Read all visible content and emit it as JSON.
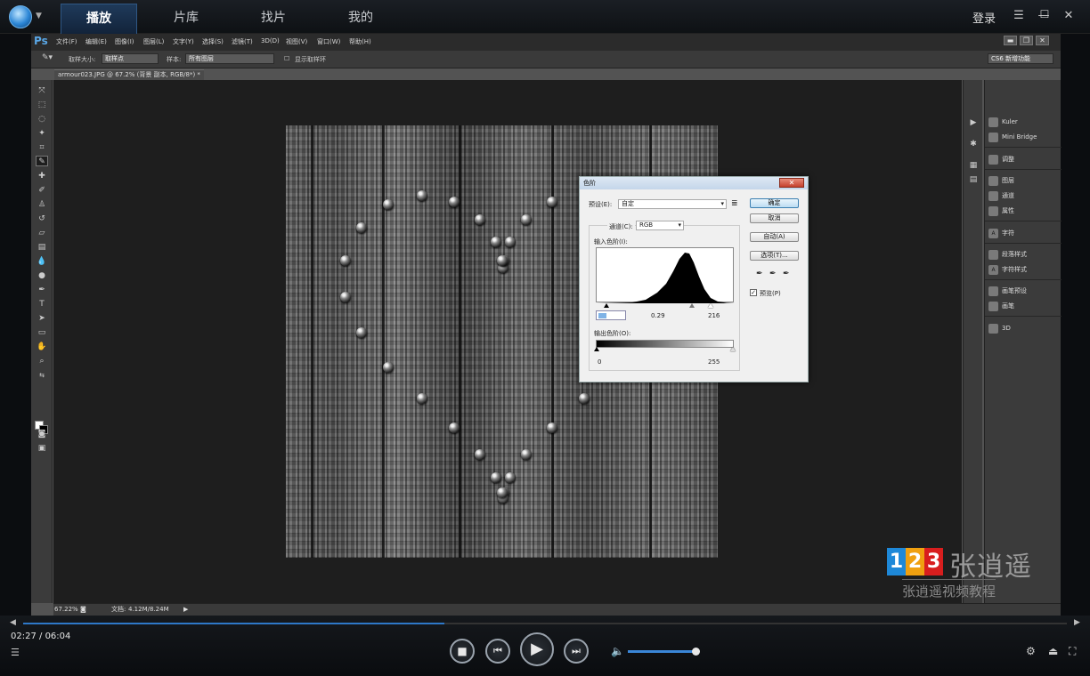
{
  "player": {
    "tabs": [
      {
        "label": "播放",
        "active": true
      },
      {
        "label": "片库",
        "active": false
      },
      {
        "label": "找片",
        "active": false
      },
      {
        "label": "我的",
        "active": false
      }
    ],
    "login": "登录",
    "time_current": "02:27",
    "time_sep": " / ",
    "time_total": "06:04",
    "progress_fraction": 0.404,
    "volume_fraction": 1.0
  },
  "ps": {
    "logo": "Ps",
    "menus": [
      "文件(F)",
      "编辑(E)",
      "图像(I)",
      "图层(L)",
      "文字(Y)",
      "选择(S)",
      "滤镜(T)",
      "3D(D)",
      "视图(V)",
      "窗口(W)",
      "帮助(H)"
    ],
    "options": {
      "sample_size_label": "取样大小:",
      "sample_size_value": "取样点",
      "sample_label": "样本:",
      "sample_value": "所有图层",
      "show_ring_label": "显示取样环",
      "workspace": "CS6 新增功能"
    },
    "doc_tab": "armour023.JPG @ 67.2% (背景 副本, RGB/8*) *",
    "status": {
      "zoom": "67.22%",
      "doc_label": "文档:",
      "doc_size": "4.12M/8.24M"
    },
    "panels": [
      "Kuler",
      "Mini Bridge",
      "调整",
      "图层",
      "通道",
      "属性",
      "字符",
      "段落样式",
      "字符样式",
      "画笔预设",
      "画笔",
      "3D"
    ]
  },
  "levels": {
    "title": "色阶",
    "preset_label": "预设(E):",
    "preset_value": "自定",
    "channel_label": "通道(C):",
    "channel_value": "RGB",
    "input_label": "输入色阶(I):",
    "input_black": "",
    "input_gamma": "0.29",
    "input_white": "216",
    "output_label": "输出色阶(O):",
    "output_black": "0",
    "output_white": "255",
    "buttons": {
      "ok": "确定",
      "cancel": "取消",
      "auto": "自动(A)",
      "options": "选项(T)..."
    },
    "preview_label": "预览(P)",
    "preview_checked": true
  },
  "watermark": {
    "digits": [
      "1",
      "2",
      "3"
    ],
    "name": "张逍遥",
    "subtitle": "张逍遥视频教程"
  },
  "colors": {
    "accent": "#2e78c8",
    "wm_1": "#1e88d8",
    "wm_2": "#f0a010",
    "wm_3": "#d81e1e"
  }
}
